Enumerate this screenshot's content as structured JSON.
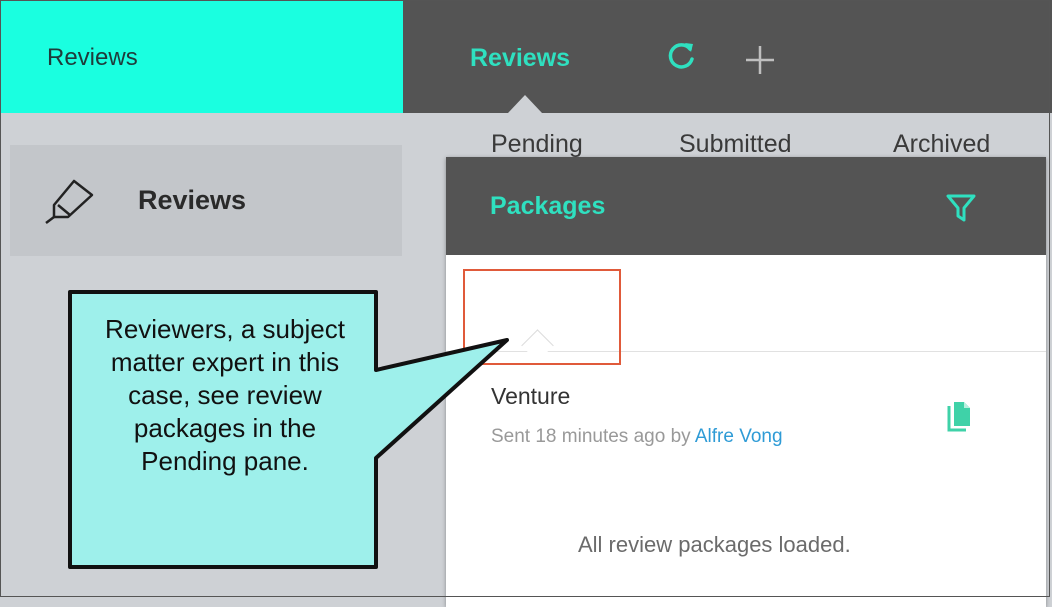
{
  "topbar": {
    "app_title": "Reviews",
    "active_tab": "Reviews",
    "refresh_icon": "refresh-icon",
    "add_icon": "plus-icon",
    "brand_color": "#1affe0",
    "accent_color": "#2fe0c0"
  },
  "sidebar": {
    "items": [
      {
        "label": "Reviews",
        "icon": "pencil-icon"
      }
    ]
  },
  "packages": {
    "title": "Packages",
    "filter_icon": "filter-icon",
    "tabs": [
      {
        "label": "Pending",
        "selected": true
      },
      {
        "label": "Submitted",
        "selected": false
      },
      {
        "label": "Archived",
        "selected": false
      }
    ],
    "items": [
      {
        "name": "Venture",
        "meta_prefix": "Sent 18 minutes ago by ",
        "author": "Alfre Vong",
        "icon": "document-icon"
      }
    ],
    "footer": "All review packages loaded."
  },
  "callout": {
    "text": "Reviewers, a subject matter expert in this case, see review packages in the Pending pane."
  }
}
